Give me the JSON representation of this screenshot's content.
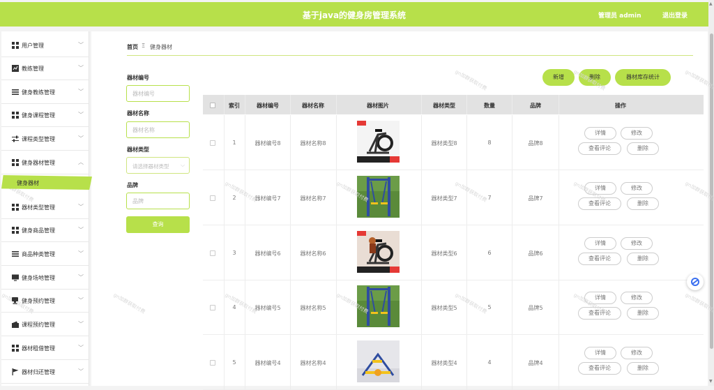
{
  "header": {
    "title": "基于java的健身房管理系统",
    "user": "管理员 admin",
    "logout": "退出登录",
    "bg_color": "#b7e04a"
  },
  "sidebar": {
    "items": [
      {
        "label": "用户管理",
        "icon": "grid-icon"
      },
      {
        "label": "教练管理",
        "icon": "chart-icon"
      },
      {
        "label": "健身教练管理",
        "icon": "list-icon"
      },
      {
        "label": "健身课程管理",
        "icon": "grid-icon"
      },
      {
        "label": "课程类型管理",
        "icon": "sliders-icon"
      },
      {
        "label": "健身器材管理",
        "icon": "grid-icon",
        "expanded": true
      },
      {
        "label": "器材类型管理",
        "icon": "grid-icon"
      },
      {
        "label": "健身商品管理",
        "icon": "grid-icon"
      },
      {
        "label": "商品种类管理",
        "icon": "list-icon"
      },
      {
        "label": "健身场地管理",
        "icon": "monitor-icon"
      },
      {
        "label": "健身预约管理",
        "icon": "cup-icon"
      },
      {
        "label": "课程预约管理",
        "icon": "wallet-icon"
      },
      {
        "label": "器材租借管理",
        "icon": "grid-icon"
      },
      {
        "label": "器材归还管理",
        "icon": "flag-icon"
      }
    ],
    "active_sub": "健身器材"
  },
  "breadcrumb": {
    "home": "首页",
    "separator": "Ξ",
    "current": "健身器材"
  },
  "filters": {
    "code_label": "器材编号",
    "code_placeholder": "器材编号",
    "name_label": "器材名称",
    "name_placeholder": "器材名称",
    "type_label": "器材类型",
    "type_placeholder": "请选择器材类型",
    "brand_label": "品牌",
    "brand_placeholder": "品牌",
    "search_button": "查询"
  },
  "actions": {
    "add": "新增",
    "delete": "删除",
    "stats": "器材库存统计"
  },
  "table": {
    "headers": [
      "索引",
      "器材编号",
      "器材名称",
      "器材图片",
      "器材类型",
      "数量",
      "品牌",
      "操作"
    ],
    "rows": [
      {
        "index": "1",
        "code": "器材编号8",
        "name": "器材名称8",
        "image": "exercise-bike-image",
        "type": "器材类型8",
        "qty": "8",
        "brand": "品牌8"
      },
      {
        "index": "2",
        "code": "器材编号7",
        "name": "器材名称7",
        "image": "outdoor-walker-image",
        "type": "器材类型7",
        "qty": "7",
        "brand": "品牌7"
      },
      {
        "index": "3",
        "code": "器材编号6",
        "name": "器材名称6",
        "image": "spin-bike-image",
        "type": "器材类型6",
        "qty": "6",
        "brand": "品牌6"
      },
      {
        "index": "4",
        "code": "器材编号5",
        "name": "器材名称5",
        "image": "outdoor-walker-image",
        "type": "器材类型5",
        "qty": "5",
        "brand": "品牌5"
      },
      {
        "index": "5",
        "code": "器材编号4",
        "name": "器材名称4",
        "image": "playground-equipment-image",
        "type": "器材类型4",
        "qty": "4",
        "brand": "品牌4"
      }
    ],
    "row_buttons": {
      "detail": "详情",
      "edit": "修改",
      "comments": "查看评论",
      "delete": "删除"
    }
  },
  "watermark": "gn加群获取付费"
}
